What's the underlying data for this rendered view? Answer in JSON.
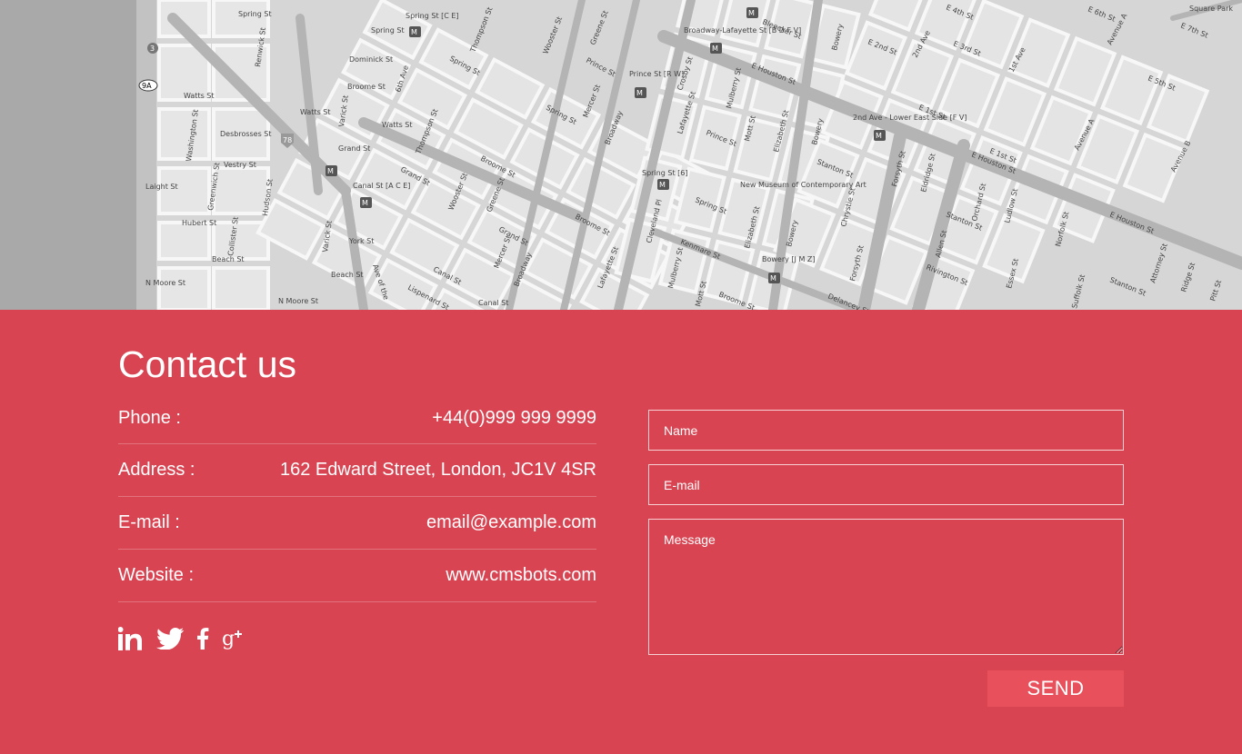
{
  "map": {
    "labels": {
      "spring_st": "Spring St",
      "renwick_st": "Renwick St",
      "dominick_st": "Dominick St",
      "watts_st": "Watts St",
      "broome_st": "Broome St",
      "desbrosses_st": "Desbrosses St",
      "grand_st": "Grand St",
      "vestry_st": "Vestry St",
      "laight_st": "Laight St",
      "hubert_st": "Hubert St",
      "beach_st": "Beach St",
      "n_moore_st": "N Moore St",
      "varick_st": "Varick St",
      "hudson_st": "Hudson St",
      "sixth_ave": "6th Ave",
      "thompson_st": "Thompson St",
      "wooster_st": "Wooster St",
      "greene_st": "Greene St",
      "mercer_st": "Mercer St",
      "broadway": "Broadway",
      "prince_st": "Prince St",
      "lafayette_st": "Lafayette St",
      "crosby_st": "Crosby St",
      "mulberry_st": "Mulberry St",
      "mott_st": "Mott St",
      "elizabeth_st": "Elizabeth St",
      "bowery": "Bowery",
      "e_houston_st": "E Houston St",
      "bleecker_st": "Bleecker St",
      "e_2nd_st": "E 2nd St",
      "e_3rd_st": "E 3rd St",
      "e_4th_st": "E 4th St",
      "e_5th_st": "E 5th St",
      "e_6th_st": "E 6th St",
      "e_7th_st": "E 7th St",
      "first_ave": "1st Ave",
      "second_ave": "2nd Ave",
      "avenue_a": "Avenue A",
      "avenue_b": "Avenue B",
      "stanton_st": "Stanton St",
      "rivington_st": "Rivington St",
      "delancey_st": "Delancey St",
      "forsyth_st": "Forsyth St",
      "chrystie_st": "Chrystie St",
      "allen_st": "Allen St",
      "orchard_st": "Orchard St",
      "ludlow_st": "Ludlow St",
      "essex_st": "Essex St",
      "norfolk_st": "Norfolk St",
      "suffolk_st": "Suffolk St",
      "ridge_st": "Ridge St",
      "pitt_st": "Pitt St",
      "kenmare_st": "Kenmare St",
      "cleveland_pl": "Cleveland Pl",
      "canal_st": "Canal St",
      "york_st": "York St",
      "museum": "New Museum of Contemporary Art",
      "square_park": "Square Park",
      "broadway_lafayette": "Broadway-Lafayette St [B D F V]",
      "second_ave_lower": "2nd Ave - Lower East Side [F V]",
      "spring_st_ce": "Spring St [C E]",
      "spring_st_6": "Spring St [6]",
      "prince_st_rw": "Prince St [R W]",
      "canal_st_ace": "Canal St [A C E]",
      "bowery_jmz": "Bowery [J M Z]",
      "e_1st_st": "E 1st St",
      "eldridge_st": "Eldridge St",
      "attorney_st": "Attorney St",
      "lispenard_st": "Lispenard St",
      "collister_st": "Collister St",
      "washington_st": "Washington St",
      "greenwich_st": "Greenwich St",
      "ave_of_the": "Ave of the",
      "i78": "78",
      "nine_a": "9A",
      "three": "3",
      "m": "M"
    }
  },
  "contact": {
    "title": "Contact us",
    "rows": [
      {
        "label": "Phone :",
        "value": "+44(0)999 999 9999"
      },
      {
        "label": "Address :",
        "value": "162 Edward Street, London, JC1V 4SR"
      },
      {
        "label": "E-mail :",
        "value": "email@example.com"
      },
      {
        "label": "Website :",
        "value": "www.cmsbots.com"
      }
    ],
    "social": [
      "linkedin-icon",
      "twitter-icon",
      "facebook-icon",
      "google-plus-icon"
    ]
  },
  "form": {
    "name_placeholder": "Name",
    "email_placeholder": "E-mail",
    "message_placeholder": "Message",
    "send_label": "SEND"
  },
  "colors": {
    "accent": "#d94452",
    "button": "#e8505c"
  }
}
